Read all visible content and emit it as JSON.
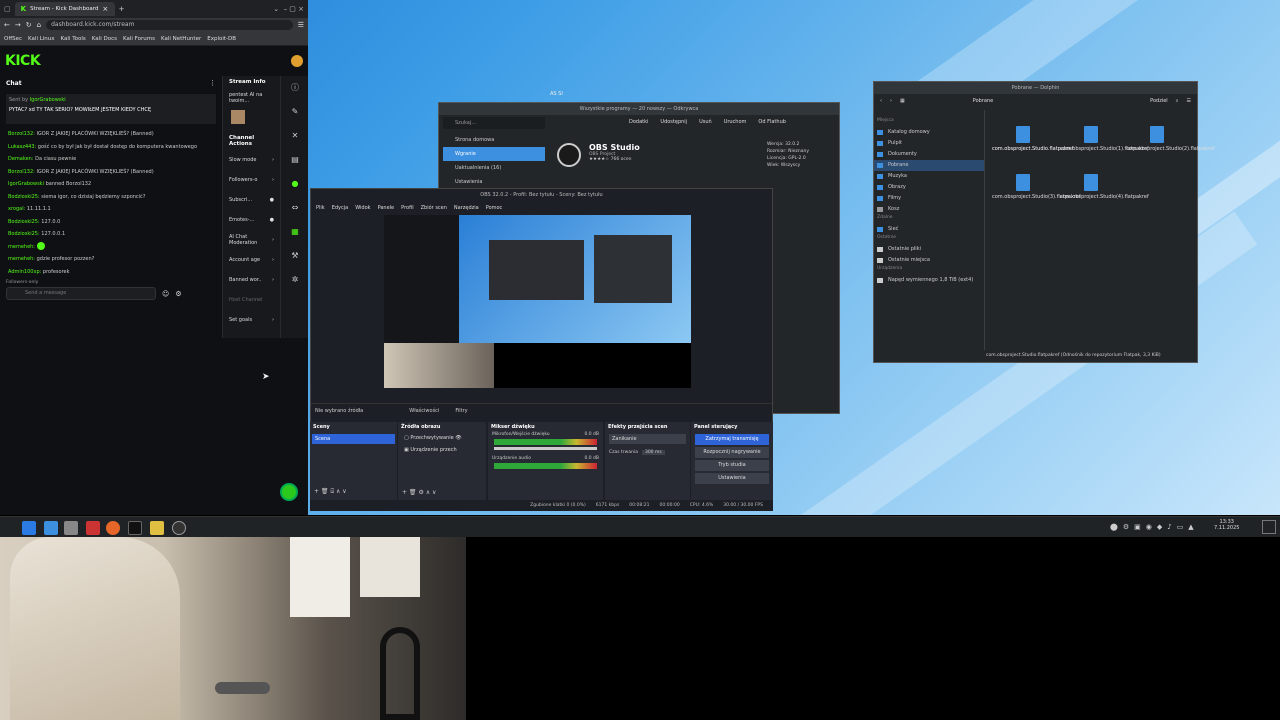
{
  "browser": {
    "tab_title": "Stream - Kick Dashboard",
    "new_tab": "+",
    "url": "dashboard.kick.com/stream",
    "bookmarks": [
      "OffSec",
      "Kali Linux",
      "Kali Tools",
      "Kali Docs",
      "Kali Forums",
      "Kali NetHunter",
      "Exploit-DB"
    ]
  },
  "kick": {
    "logo": "KICK",
    "chat_title": "Chat",
    "pinned_label": "Sent by",
    "pinned_user": "IgorGrabowski",
    "pinned_text": "PYTAC? xd TY TAK SERIO? MÓWIŁEM JESTEM KIEDY CHCĘ",
    "messages": [
      {
        "user": "Borzol132:",
        "text": "IGOR Z JAKIEJ PLACÓWKI WZIĘKLIEŚ? (Banned)"
      },
      {
        "user": "Lukasz443:",
        "text": "gość co by był jak był dostał dostęp do komputera kwantowego"
      },
      {
        "user": "Demaken:",
        "text": "Da ciasu pewnie"
      },
      {
        "user": "Borzol132:",
        "text": "IGOR Z JAKIEJ PLACÓWKI WZIĘKLIEŚ? (Banned)"
      },
      {
        "user": "IgorGrabowski",
        "text": "banned Borzol132"
      },
      {
        "user": "Bodzioski25:",
        "text": "siema igor, co dzisiaj będziemy szponcić?"
      },
      {
        "user": "xrogal:",
        "text": "11.11.1.1"
      },
      {
        "user": "Bodzioski25:",
        "text": "127.0.0"
      },
      {
        "user": "Bodzioski25:",
        "text": "127.0.0.1"
      },
      {
        "user": "memeheh:",
        "text": ""
      },
      {
        "user": "memeheh:",
        "text": "gdzie profesor pozzen?"
      },
      {
        "user": "Admin100xp:",
        "text": "profesorek"
      }
    ],
    "followers_only": "Followers-only",
    "send_placeholder": "Send a message",
    "stream_info": "Stream Info",
    "stream_title": "pentest AI na twoim...",
    "channel_actions": "Channel Actions",
    "side_items": [
      "Slow mode",
      "Followers-o",
      "Subscri...",
      "Emotes-...",
      "AI Chat Moderation",
      "Account age",
      "Banned wor..",
      "Host Channel",
      "Set goals"
    ]
  },
  "software": {
    "title": "Wszystkie programy — 20 nowszy — Odkrywca",
    "nav": [
      "Strona domowa",
      "Wgranie",
      "Uaktualnienia (16)",
      "Ustawienia"
    ],
    "actions": [
      "Dodatki",
      "Udostępnij",
      "Usuń",
      "Uruchom",
      "Od Flathub"
    ],
    "app_name": "OBS Studio",
    "app_dev": "OBS Project",
    "app_ratings": "766 ocen",
    "version": "Wersja: 32.0.2",
    "size": "Rozmiar: Nieznany",
    "license": "Licencja: GPL-2.0",
    "downloads": "Wiek: Wszyscy",
    "top_label": "AS SI"
  },
  "dolphin": {
    "title": "Pobrane — Dolphin",
    "breadcrumb": "Pobrane",
    "view_label": "Podziel",
    "section_places": "Miejsca",
    "places": [
      "Katalog domowy",
      "Pulpit",
      "Dokumenty",
      "Pobrane",
      "Muzyka",
      "Obrazy",
      "Filmy",
      "Kosz"
    ],
    "section_remote": "Zdalne",
    "remote": [
      "Sieć"
    ],
    "section_recent": "Ostatnie",
    "recent": [
      "Ostatnie pliki",
      "Ostatnie miejsca"
    ],
    "section_devices": "Urządzenia",
    "devices": [
      "Napęd wymiennego 1,8 TiB (ext4)"
    ],
    "files": [
      "com.obsproject.Studio.flatpakref",
      "com.obsproject.Studio(1).flatpakref",
      "com.obsproject.Studio(2).flatpakref",
      "com.obsproject.Studio(3).flatpakref",
      "com.obsproject.Studio(4).flatpakref"
    ],
    "status": "com.obsproject.Studio.flatpakref (Odnośnik do repozytorium Flatpak, 3,3 KiB)"
  },
  "obs": {
    "title": "OBS 32.0.2 - Profil: Bez tytułu - Sceny: Bez tytułu",
    "menu": [
      "Plik",
      "Edycja",
      "Widok",
      "Panele",
      "Profil",
      "Zbiór scen",
      "Narzędzia",
      "Pomoc"
    ],
    "no_source": "Nie wybrano źródła",
    "properties": "Właściwości",
    "filters": "Filtry",
    "scenes_title": "Sceny",
    "scene": "Scena",
    "sources_title": "Źródła obrazu",
    "sources": [
      "Przechwytywanie",
      "Urządzenie przech"
    ],
    "mixer_title": "Mikser dźwięku",
    "mixer_tracks": [
      "Mikrofon/Wejście dźwięku",
      "Urządzenie audio"
    ],
    "mixer_db": [
      "0.0 dB",
      "0.0 dB"
    ],
    "transitions_title": "Efekty przejścia scen",
    "transition": "Zanikanie",
    "duration_label": "Czas trwania",
    "duration": "300 ms",
    "controls_title": "Panel sterujący",
    "controls": [
      "Zatrzymaj transmisję",
      "Rozpocznij nagrywanie",
      "Tryb studia",
      "Ustawienia"
    ],
    "status": [
      "Zgubione klatki 0 (0.0%)",
      "6171 kbps",
      "00:08:21",
      "00:00:00",
      "CPU: 4.6%",
      "30.00 / 30.00 FPS"
    ]
  },
  "taskbar": {
    "time": "13:33",
    "date": "7.11.2025"
  },
  "colors": {
    "kick_green": "#53fc18",
    "obs_bg": "#1d1f26",
    "accent_blue": "#3d8fe0",
    "stop_btn": "#2e64d8"
  }
}
